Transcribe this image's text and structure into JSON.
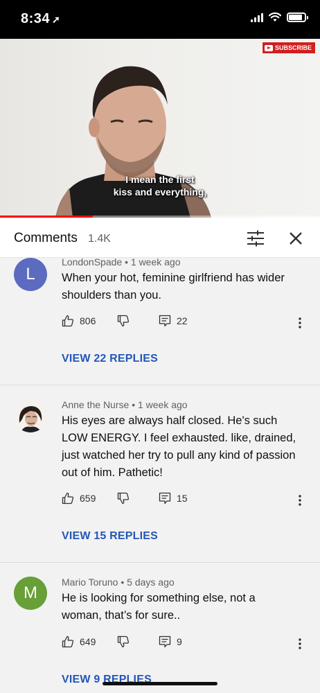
{
  "status_bar": {
    "time": "8:34",
    "location_glyph": "➚"
  },
  "video": {
    "subscribe_label": "SUBSCRIBE",
    "caption_line1": "I mean the first",
    "caption_line2": "kiss and everything,",
    "progress_fraction": 0.29
  },
  "comments_panel": {
    "title": "Comments",
    "count": "1.4K",
    "sort_icon": "sort-filter-icon",
    "close_icon": "close-icon"
  },
  "comments": [
    {
      "author": "LondonSpade",
      "time": "1 week ago",
      "avatar_letter": "L",
      "avatar_color": "#5c6bc0",
      "text": "When your hot, feminine girlfriend has wider shoulders than you.",
      "likes": "806",
      "replies_count": "22",
      "view_replies": "VIEW 22 REPLIES"
    },
    {
      "author": "Anne the Nurse",
      "time": "1 week ago",
      "avatar_letter": "",
      "avatar_color": "#ffffff",
      "text": "His eyes are always half closed. He's such LOW ENERGY. I feel exhausted. like, drained, just watched her try to pull any kind of passion out of him. Pathetic!",
      "likes": "659",
      "replies_count": "15",
      "view_replies": "VIEW 15 REPLIES"
    },
    {
      "author": "Mario Toruno",
      "time": "5 days ago",
      "avatar_letter": "M",
      "avatar_color": "#689f38",
      "text": "He is looking for something else, not a woman, that’s for sure..",
      "likes": "649",
      "replies_count": "9",
      "view_replies": "VIEW 9 REPLIES"
    }
  ],
  "separator": "•",
  "accent_color": "#2356b8"
}
